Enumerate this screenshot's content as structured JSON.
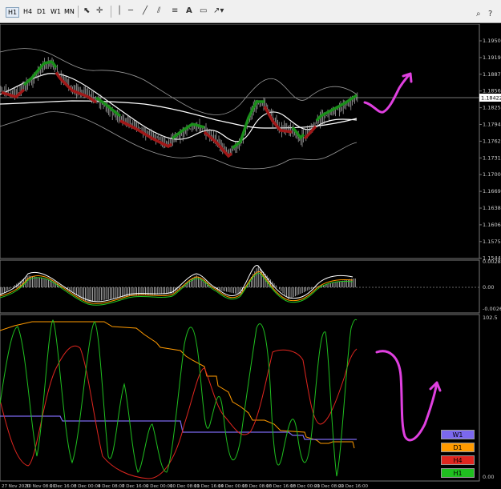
{
  "toolbar": {
    "timeframes": [
      "H1",
      "H4",
      "D1",
      "W1",
      "MN"
    ],
    "active_timeframe": "H1",
    "text_tool": "A"
  },
  "main_chart": {
    "price_labels": [
      "1.19500",
      "1.19190",
      "1.18875",
      "1.18565",
      "1.18250",
      "1.17940",
      "1.17625",
      "1.17315",
      "1.17005",
      "1.16690",
      "1.16380",
      "1.16065",
      "1.15755",
      "1.15440"
    ],
    "current_price_label": "1.18422"
  },
  "macd_panel": {
    "labels": [
      "0.0028",
      "0.00",
      "-0.0026"
    ]
  },
  "osc_panel": {
    "labels": [
      "102.5",
      "0.00"
    ]
  },
  "legend": {
    "items": [
      {
        "label": "W1",
        "color": "#7b68ee",
        "text_color": "#000"
      },
      {
        "label": "D1",
        "color": "#ff9a00",
        "text_color": "#000"
      },
      {
        "label": "H4",
        "color": "#e0261f",
        "text_color": "#000"
      },
      {
        "label": "H1",
        "color": "#1fbf1f",
        "text_color": "#000"
      }
    ]
  },
  "time_axis": [
    "27 Nov 2020",
    "30 Nov 08:00",
    "1 Dec 16:00",
    "3 Dec 00:00",
    "4 Dec 08:00",
    "7 Dec 16:00",
    "9 Dec 00:00",
    "10 Dec 08:00",
    "11 Dec 16:00",
    "14 Dec 00:00",
    "15 Dec 08:00",
    "16 Dec 16:00",
    "18 Dec 00:00",
    "21 Dec 08:00",
    "22 Dec 16:00"
  ],
  "colors": {
    "annotation": "#e040e0",
    "bull_band": "#1a8f1a",
    "bear_band": "#a01818"
  }
}
